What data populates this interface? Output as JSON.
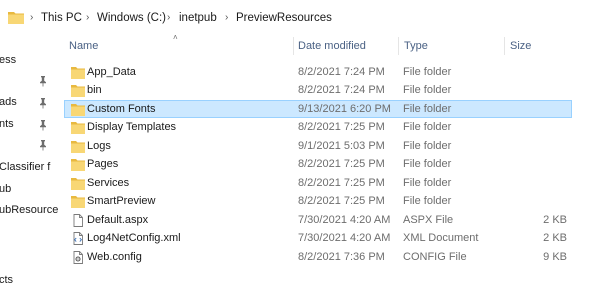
{
  "breadcrumb": {
    "items": [
      "This PC",
      "Windows (C:)",
      "inetpub",
      "PreviewResources"
    ]
  },
  "nav_pane": {
    "items": [
      "ess",
      "ads",
      "nts",
      "Classifier f",
      "ub",
      "ubResource",
      "cts"
    ]
  },
  "columns": {
    "name": "Name",
    "date": "Date modified",
    "type": "Type",
    "size": "Size"
  },
  "files": [
    {
      "name": "App_Data",
      "date": "8/2/2021 7:24 PM",
      "type": "File folder",
      "size": "",
      "icon": "folder-icon"
    },
    {
      "name": "bin",
      "date": "8/2/2021 7:24 PM",
      "type": "File folder",
      "size": "",
      "icon": "folder-icon"
    },
    {
      "name": "Custom Fonts",
      "date": "9/13/2021 6:20 PM",
      "type": "File folder",
      "size": "",
      "icon": "folder-icon"
    },
    {
      "name": "Display Templates",
      "date": "8/2/2021 7:25 PM",
      "type": "File folder",
      "size": "",
      "icon": "folder-icon"
    },
    {
      "name": "Logs",
      "date": "9/1/2021 5:03 PM",
      "type": "File folder",
      "size": "",
      "icon": "folder-icon"
    },
    {
      "name": "Pages",
      "date": "8/2/2021 7:25 PM",
      "type": "File folder",
      "size": "",
      "icon": "folder-icon"
    },
    {
      "name": "Services",
      "date": "8/2/2021 7:25 PM",
      "type": "File folder",
      "size": "",
      "icon": "folder-icon"
    },
    {
      "name": "SmartPreview",
      "date": "8/2/2021 7:25 PM",
      "type": "File folder",
      "size": "",
      "icon": "folder-icon"
    },
    {
      "name": "Default.aspx",
      "date": "7/30/2021 4:20 AM",
      "type": "ASPX File",
      "size": "2 KB",
      "icon": "document-icon"
    },
    {
      "name": "Log4NetConfig.xml",
      "date": "7/30/2021 4:20 AM",
      "type": "XML Document",
      "size": "2 KB",
      "icon": "xml-file-icon"
    },
    {
      "name": "Web.config",
      "date": "8/2/2021 7:36 PM",
      "type": "CONFIG File",
      "size": "9 KB",
      "icon": "config-file-icon"
    }
  ],
  "selected_row": "Custom Fonts",
  "colors": {
    "selection_bg": "#cce8ff",
    "selection_border": "#99d1ff",
    "folder_yellow": "#f8d775",
    "header_text": "#4a6184"
  }
}
